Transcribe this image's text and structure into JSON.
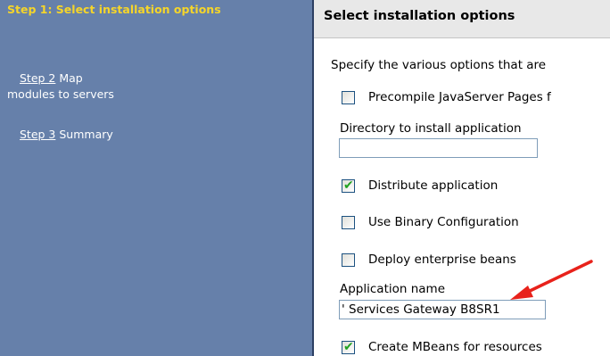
{
  "sidebar": {
    "current_step": "Step 1: Select installation options",
    "step2_link": "Step 2",
    "step2_text": " Map",
    "step2_text2": "modules to servers",
    "step3_link": "Step 3",
    "step3_text": " Summary"
  },
  "header": {
    "title": "Select installation options"
  },
  "main": {
    "description": "Specify the various options that are",
    "options": {
      "precompile": {
        "label": "Precompile JavaServer Pages f",
        "checked": false
      },
      "distribute": {
        "label": "Distribute application",
        "checked": true
      },
      "binary": {
        "label": "Use Binary Configuration",
        "checked": false
      },
      "deploy": {
        "label": "Deploy enterprise beans",
        "checked": false
      },
      "mbeans": {
        "label": "Create MBeans for resources",
        "checked": true
      }
    },
    "directory_label": "Directory to install application",
    "directory_value": "",
    "app_name_label": "Application name",
    "app_name_value": "' Services Gateway B8SR1"
  },
  "colors": {
    "sidebar": "#6680aa",
    "current_step": "#f5d52a",
    "check": "#21a121",
    "arrow": "#e8221b"
  },
  "icons": {
    "check": "checkmark-icon",
    "arrow": "red-arrow-annotation"
  }
}
